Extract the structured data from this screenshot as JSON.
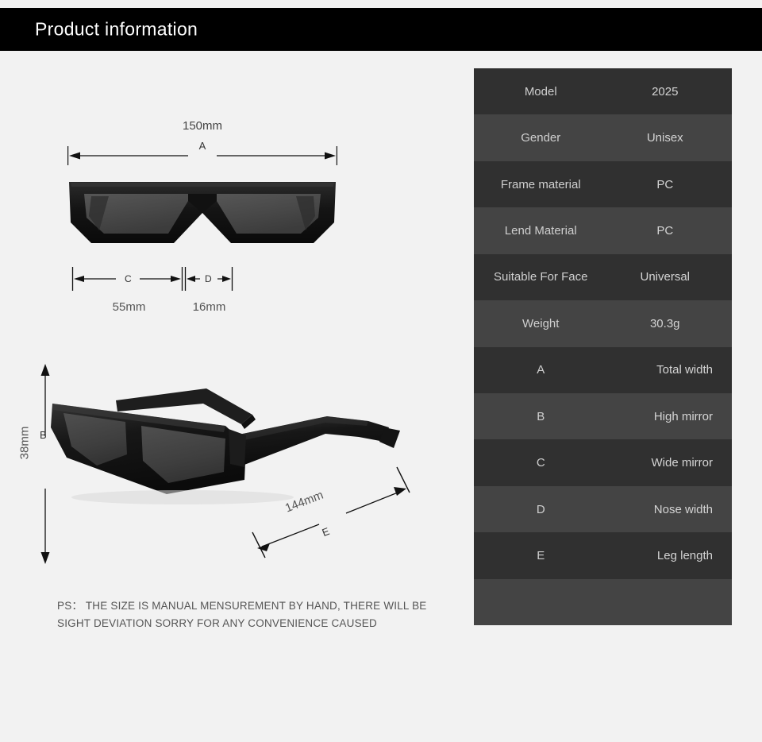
{
  "header": {
    "title": "Product information"
  },
  "diagram": {
    "front_view": {
      "icon": "sunglasses-front-view",
      "dimension_a": {
        "value": "150mm",
        "letter": "A"
      },
      "dimension_c": {
        "value": "55mm",
        "letter": "C"
      },
      "dimension_d": {
        "value": "16mm",
        "letter": "D"
      }
    },
    "side_view": {
      "icon": "sunglasses-angled-view",
      "dimension_b": {
        "value": "38mm",
        "letter": "B"
      },
      "dimension_e": {
        "value": "144mm",
        "letter": "E"
      }
    },
    "note": "PS： THE SIZE IS MANUAL MENSUREMENT BY HAND, THERE WILL BE SIGHT DEVIATION SORRY FOR ANY CONVENIENCE CAUSED"
  },
  "spec_table": {
    "rows": [
      {
        "label": "Model",
        "value": "2025"
      },
      {
        "label": "Gender",
        "value": "Unisex"
      },
      {
        "label": "Frame material",
        "value": "PC"
      },
      {
        "label": "Lend Material",
        "value": "PC"
      },
      {
        "label": "Suitable For Face",
        "value": "Universal"
      },
      {
        "label": "Weight",
        "value": "30.3g"
      },
      {
        "label": "A",
        "value": "Total width"
      },
      {
        "label": "B",
        "value": "High mirror"
      },
      {
        "label": "C",
        "value": "Wide mirror"
      },
      {
        "label": "D",
        "value": "Nose width"
      },
      {
        "label": "E",
        "value": "Leg length"
      },
      {
        "label": "",
        "value": ""
      }
    ]
  },
  "colors": {
    "page_background": "#f2f2f2",
    "header_background": "#000000",
    "header_text": "#ffffff",
    "row_dark": "#303030",
    "row_light": "#444444",
    "row_text": "#cfcfcf",
    "frame_black": "#1a1a1a",
    "lens_gray": "#4a4a4a",
    "dimension_line": "#111111",
    "note_text": "#555555"
  }
}
